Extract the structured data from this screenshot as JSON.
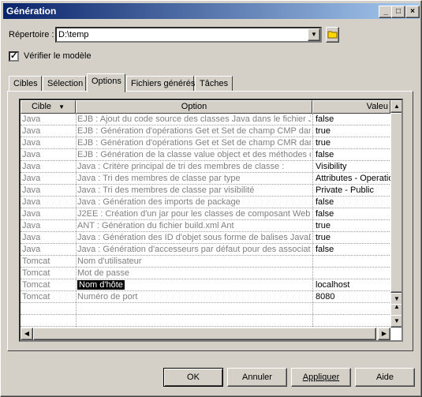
{
  "window": {
    "title": "Génération"
  },
  "directory": {
    "label": "Répertoire :",
    "value": "D:\\temp"
  },
  "verify": {
    "label": "Vérifier le modèle",
    "checked": true
  },
  "tabs": [
    {
      "label": "Cibles"
    },
    {
      "label": "Sélection"
    },
    {
      "label": "Options",
      "active": true
    },
    {
      "label": "Fichiers générés"
    },
    {
      "label": "Tâches"
    }
  ],
  "table": {
    "columns": [
      "Cible",
      "Option",
      "Valeu"
    ],
    "rows": [
      {
        "target": "Java",
        "option": "EJB : Ajout du code source des classes Java dans le fichier JA",
        "value": "false"
      },
      {
        "target": "Java",
        "option": "EJB : Génération d'opérations Get et Set de champ CMP dans",
        "value": "true"
      },
      {
        "target": "Java",
        "option": "EJB : Génération d'opérations Get et Set de champ CMR dans",
        "value": "true"
      },
      {
        "target": "Java",
        "option": "EJB : Génération de la classe value object et des méthodes de",
        "value": "false"
      },
      {
        "target": "Java",
        "option": "Java : Critère principal de tri des membres de classe :",
        "value": "Visibility"
      },
      {
        "target": "Java",
        "option": "Java : Tri des membres de classe par type",
        "value": "Attributes - Operation"
      },
      {
        "target": "Java",
        "option": "Java : Tri des membres de classe par visibilité",
        "value": "Private - Public"
      },
      {
        "target": "Java",
        "option": "Java : Génération des imports de package",
        "value": "false"
      },
      {
        "target": "Java",
        "option": "J2EE : Création d'un jar pour les classes de composant Web",
        "value": "false"
      },
      {
        "target": "Java",
        "option": "ANT : Génération du fichier build.xml Ant",
        "value": "true"
      },
      {
        "target": "Java",
        "option": "Java : Génération des ID d'objet sous forme de balises JavaDo",
        "value": "true"
      },
      {
        "target": "Java",
        "option": "Java : Génération d'accesseurs par défaut pour des associatio",
        "value": "false"
      },
      {
        "target": "Tomcat",
        "option": "Nom d'utilisateur",
        "value": ""
      },
      {
        "target": "Tomcat",
        "option": "Mot de passe",
        "value": ""
      },
      {
        "target": "Tomcat",
        "option": "Nom d'hôte",
        "value": "localhost",
        "selected": true
      },
      {
        "target": "Tomcat",
        "option": "Numéro de port",
        "value": "8080"
      }
    ]
  },
  "buttons": {
    "ok": "OK",
    "cancel": "Annuler",
    "apply": "Appliquer",
    "help": "Aide"
  },
  "icons": {
    "folder": "folder-icon",
    "dropdown": "chevron-down-icon"
  }
}
